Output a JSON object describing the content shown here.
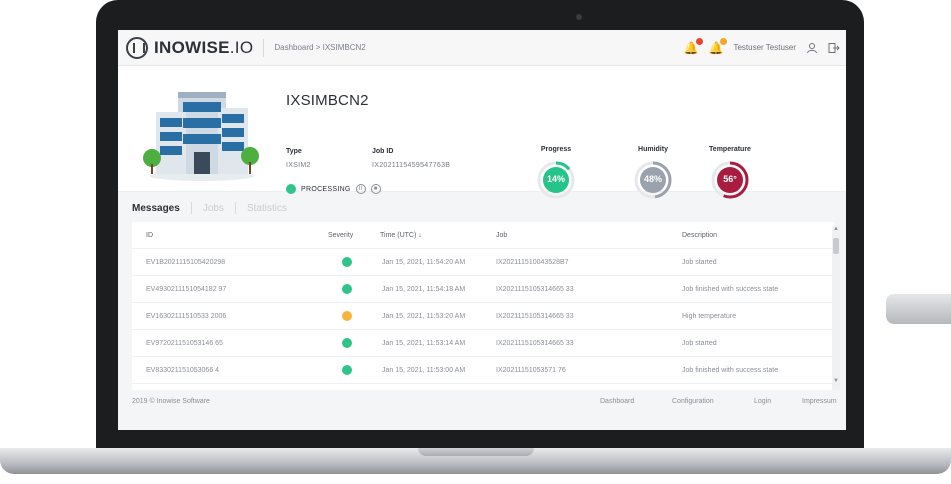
{
  "header": {
    "logo_text_bold": "INOWISE",
    "logo_text_rest": ".IO",
    "breadcrumb": "Dashboard > IXSIMBCN2",
    "user_name": "Testuser Testuser",
    "colors": {
      "bell_red": "#e8452c",
      "bell_orange": "#f5a623"
    }
  },
  "job": {
    "title": "IXSIMBCN2",
    "type_label": "Type",
    "type_value": "IXSIM2",
    "jobid_label": "Job ID",
    "jobid_value": "IX2021115459547763B",
    "status": "PROCESSING",
    "status_color": "#2fc58a",
    "gauges": [
      {
        "label": "Progress",
        "value": "14%",
        "fill": 0.14,
        "color": "#25c48a"
      },
      {
        "label": "Humidity",
        "value": "48%",
        "fill": 0.48,
        "color": "#9aa3ad"
      },
      {
        "label": "Temperature",
        "value": "56°",
        "fill": 0.56,
        "color": "#a91c3f"
      }
    ]
  },
  "tabs": [
    "Messages",
    "Jobs",
    "Statistics"
  ],
  "table": {
    "columns": [
      "ID",
      "Severity",
      "Time (UTC) ↓",
      "Job",
      "Description"
    ],
    "rows": [
      {
        "id": "EV1B2021115105420298",
        "severity": "#2fc58a",
        "time": "Jan 15, 2021, 11:54:20 AM",
        "job": "IX202111510043528B7",
        "desc": "Job started"
      },
      {
        "id": "EV4930211151054182 97",
        "severity": "#2fc58a",
        "time": "Jan 15, 2021, 11:54:18 AM",
        "job": "IX2021115105314665 33",
        "desc": "Job finished with success state"
      },
      {
        "id": "EV16302111510533 2006",
        "severity": "#f5b53a",
        "time": "Jan 15, 2021, 11:53:20 AM",
        "job": "IX2021115105314665 33",
        "desc": "High temperature"
      },
      {
        "id": "EV972021151053146 65",
        "severity": "#2fc58a",
        "time": "Jan 15, 2021, 11:53:14 AM",
        "job": "IX2021115105314665 33",
        "desc": "Job started"
      },
      {
        "id": "EV833021151053066 4",
        "severity": "#2fc58a",
        "time": "Jan 15, 2021, 11:53:00 AM",
        "job": "IX20211151053571 76",
        "desc": "Job finished with success state"
      }
    ]
  },
  "footer": {
    "copyright": "2019 © Inowise Software",
    "links": [
      "Dashboard",
      "Configuration",
      "Login",
      "Impressum"
    ]
  }
}
